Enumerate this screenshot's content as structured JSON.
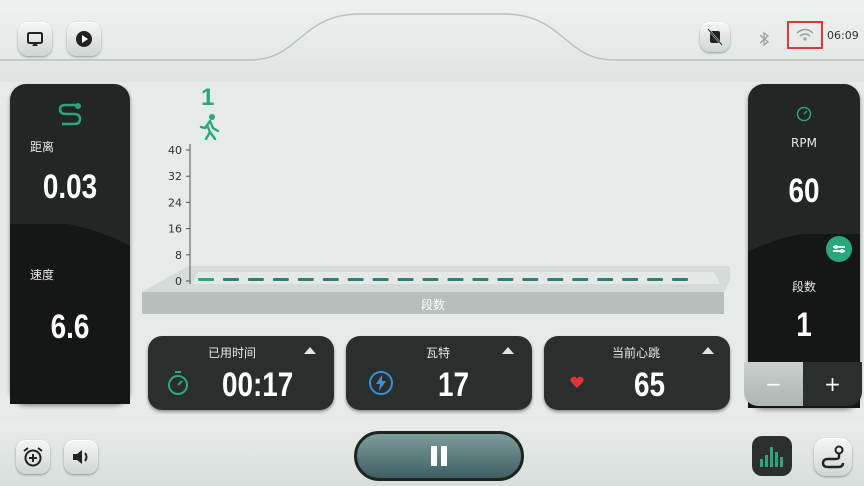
{
  "status_bar": {
    "time": "06:09"
  },
  "left_panel": {
    "distance_label": "距离",
    "distance_value": "0.03",
    "speed_label": "速度",
    "speed_value": "6.6"
  },
  "right_panel": {
    "rpm_label": "RPM",
    "rpm_value": "60",
    "level_label": "段数",
    "level_value": "1",
    "minus_label": "−",
    "plus_label": "+"
  },
  "lap": {
    "current": "1"
  },
  "chart_data": {
    "type": "bar",
    "xlabel": "段数",
    "ylabel": "",
    "ylim": [
      0,
      40
    ],
    "y_ticks": [
      "0",
      "8",
      "16",
      "24",
      "32",
      "40"
    ],
    "segment_count": 20,
    "values": [
      0,
      0,
      0,
      0,
      0,
      0,
      0,
      0,
      0,
      0,
      0,
      0,
      0,
      0,
      0,
      0,
      0,
      0,
      0,
      0
    ]
  },
  "stats": {
    "elapsed_title": "已用时间",
    "elapsed_value": "00:17",
    "watts_title": "瓦特",
    "watts_value": "17",
    "heart_title": "当前心跳",
    "heart_value": "65"
  },
  "colors": {
    "accent": "#2aa87c",
    "panel": "#222624",
    "alert": "#e03a36"
  }
}
